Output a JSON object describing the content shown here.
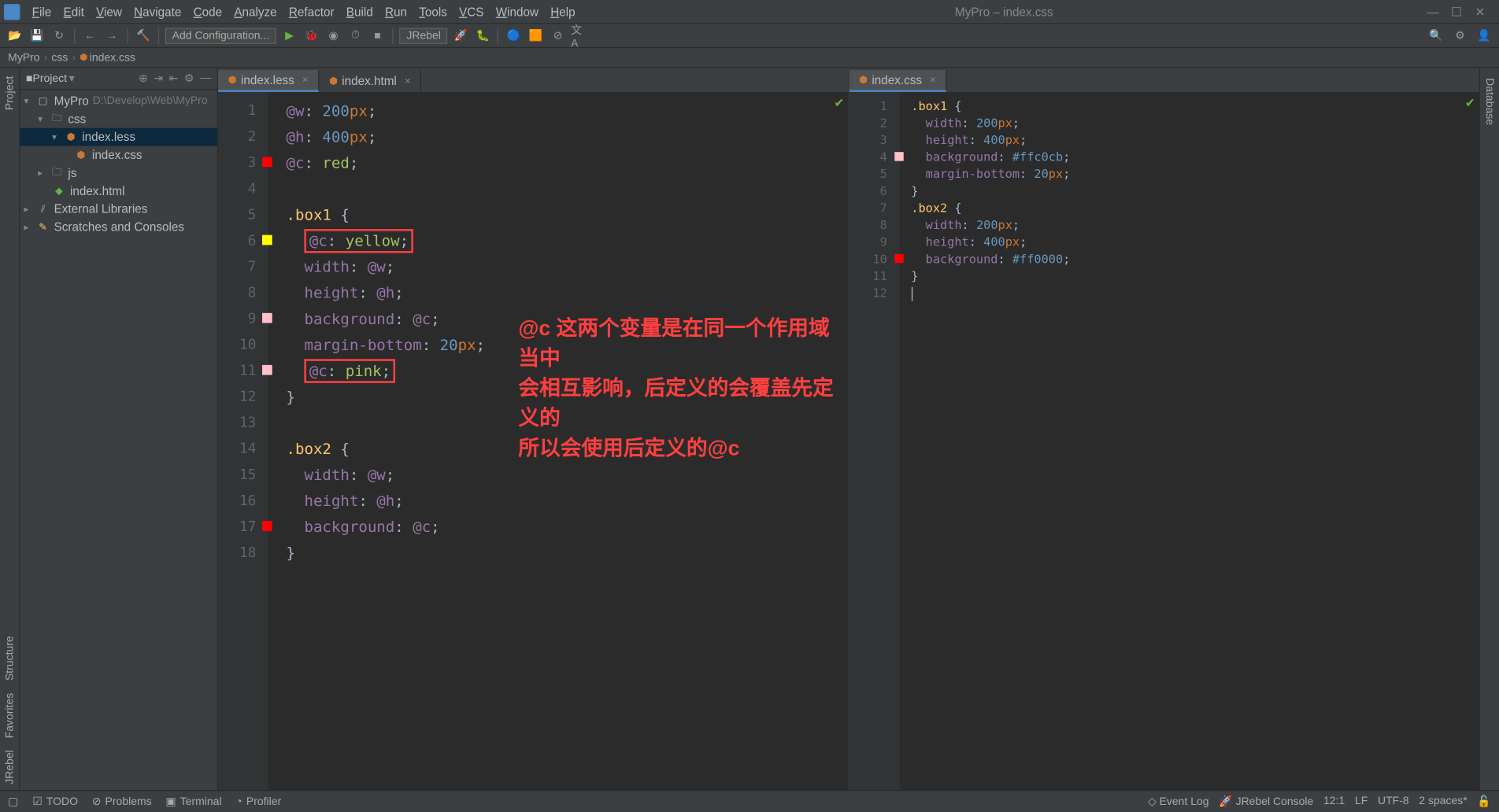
{
  "window_title": "MyPro – index.css",
  "menu": [
    "File",
    "Edit",
    "View",
    "Navigate",
    "Code",
    "Analyze",
    "Refactor",
    "Build",
    "Run",
    "Tools",
    "VCS",
    "Window",
    "Help"
  ],
  "config_label": "Add Configuration...",
  "jrebel_label": "JRebel",
  "breadcrumb": [
    "MyPro",
    "css",
    "index.css"
  ],
  "left_tabs": [
    "Project",
    "Structure",
    "Favorites",
    "JRebel"
  ],
  "right_tabs": [
    "Database"
  ],
  "project_header": "Project",
  "tree": {
    "root": "MyPro",
    "root_path": "D:\\Develop\\Web\\MyPro",
    "css": "css",
    "index_less": "index.less",
    "index_css": "index.css",
    "js": "js",
    "index_html": "index.html",
    "ext_lib": "External Libraries",
    "scratches": "Scratches and Consoles"
  },
  "tabs_left": [
    {
      "name": "index.less",
      "active": true
    },
    {
      "name": "index.html",
      "active": false
    }
  ],
  "tabs_right": [
    {
      "name": "index.css",
      "active": true
    }
  ],
  "left_code": {
    "lines": [
      {
        "n": 1,
        "html": "<span class='varname'>@w</span><span class='punct'>:</span> <span class='num'>200</span><span class='kw'>px</span><span class='punct'>;</span>"
      },
      {
        "n": 2,
        "html": "<span class='varname'>@h</span><span class='punct'>:</span> <span class='num'>400</span><span class='kw'>px</span><span class='punct'>;</span>"
      },
      {
        "n": 3,
        "swatch": "#ff0000",
        "html": "<span class='varname'>@c</span><span class='punct'>:</span> <span class='val'>red</span><span class='punct'>;</span>"
      },
      {
        "n": 4,
        "html": " "
      },
      {
        "n": 5,
        "fold": "-",
        "html": "<span class='sel-css'>.box1</span> <span class='punct'>{</span>"
      },
      {
        "n": 6,
        "swatch": "#ffff00",
        "html": "  <span class='redbox'><span class='varname'>@c</span><span class='punct'>:</span> <span class='val'>yellow</span><span class='punct'>;</span></span>"
      },
      {
        "n": 7,
        "html": "  <span class='prop'>width</span><span class='punct'>:</span> <span class='varname'>@w</span><span class='punct'>;</span>"
      },
      {
        "n": 8,
        "html": "  <span class='prop'>height</span><span class='punct'>:</span> <span class='varname'>@h</span><span class='punct'>;</span>"
      },
      {
        "n": 9,
        "swatch": "#ffc0cb",
        "html": "  <span class='prop'>background</span><span class='punct'>:</span> <span class='varname'>@c</span><span class='punct'>;</span>"
      },
      {
        "n": 10,
        "html": "  <span class='prop'>margin-bottom</span><span class='punct'>:</span> <span class='num'>20</span><span class='kw'>px</span><span class='punct'>;</span>"
      },
      {
        "n": 11,
        "swatch": "#ffc0cb",
        "html": "  <span class='redbox'><span class='varname'>@c</span><span class='punct'>:</span> <span class='val'>pink</span><span class='punct'>;</span></span>"
      },
      {
        "n": 12,
        "fold": "-",
        "html": "<span class='punct'>}</span>"
      },
      {
        "n": 13,
        "html": " "
      },
      {
        "n": 14,
        "fold": "-",
        "html": "<span class='sel-css'>.box2</span> <span class='punct'>{</span>"
      },
      {
        "n": 15,
        "html": "  <span class='prop'>width</span><span class='punct'>:</span> <span class='varname'>@w</span><span class='punct'>;</span>"
      },
      {
        "n": 16,
        "html": "  <span class='prop'>height</span><span class='punct'>:</span> <span class='varname'>@h</span><span class='punct'>;</span>"
      },
      {
        "n": 17,
        "swatch": "#ff0000",
        "html": "  <span class='prop'>background</span><span class='punct'>:</span> <span class='varname'>@c</span><span class='punct'>;</span>"
      },
      {
        "n": 18,
        "fold": "-",
        "html": "<span class='punct'>}</span>"
      }
    ]
  },
  "right_code": {
    "lines": [
      {
        "n": 1,
        "fold": "-",
        "html": "<span class='sel-css'>.box1</span> <span class='punct'>{</span>"
      },
      {
        "n": 2,
        "html": "  <span class='prop'>width</span><span class='punct'>:</span> <span class='num'>200</span><span class='kw'>px</span><span class='punct'>;</span>"
      },
      {
        "n": 3,
        "html": "  <span class='prop'>height</span><span class='punct'>:</span> <span class='num'>400</span><span class='kw'>px</span><span class='punct'>;</span>"
      },
      {
        "n": 4,
        "swatch": "#ffc0cb",
        "html": "  <span class='prop'>background</span><span class='punct'>:</span> <span class='num'>#ffc0cb</span><span class='punct'>;</span>"
      },
      {
        "n": 5,
        "html": "  <span class='prop'>margin-bottom</span><span class='punct'>:</span> <span class='num'>20</span><span class='kw'>px</span><span class='punct'>;</span>"
      },
      {
        "n": 6,
        "fold": "-",
        "html": "<span class='punct'>}</span>"
      },
      {
        "n": 7,
        "fold": "-",
        "html": "<span class='sel-css'>.box2</span> <span class='punct'>{</span>"
      },
      {
        "n": 8,
        "html": "  <span class='prop'>width</span><span class='punct'>:</span> <span class='num'>200</span><span class='kw'>px</span><span class='punct'>;</span>"
      },
      {
        "n": 9,
        "html": "  <span class='prop'>height</span><span class='punct'>:</span> <span class='num'>400</span><span class='kw'>px</span><span class='punct'>;</span>"
      },
      {
        "n": 10,
        "swatch": "#ff0000",
        "html": "  <span class='prop'>background</span><span class='punct'>:</span> <span class='num'>#ff0000</span><span class='punct'>;</span>"
      },
      {
        "n": 11,
        "fold": "-",
        "html": "<span class='punct'>}</span>"
      },
      {
        "n": 12,
        "html": "<span class='caret'></span>"
      }
    ]
  },
  "annotation_lines": [
    "@c 这两个变量是在同一个作用域当中",
    "会相互影响，后定义的会覆盖先定义的",
    "所以会使用后定义的@c"
  ],
  "status": {
    "items": [
      "TODO",
      "Problems",
      "Terminal",
      "Profiler"
    ],
    "right": [
      "Event Log",
      "JRebel Console"
    ],
    "pos": "12:1",
    "lf": "LF",
    "enc": "UTF-8",
    "indent": "2 spaces*",
    "lock": "🔓"
  }
}
